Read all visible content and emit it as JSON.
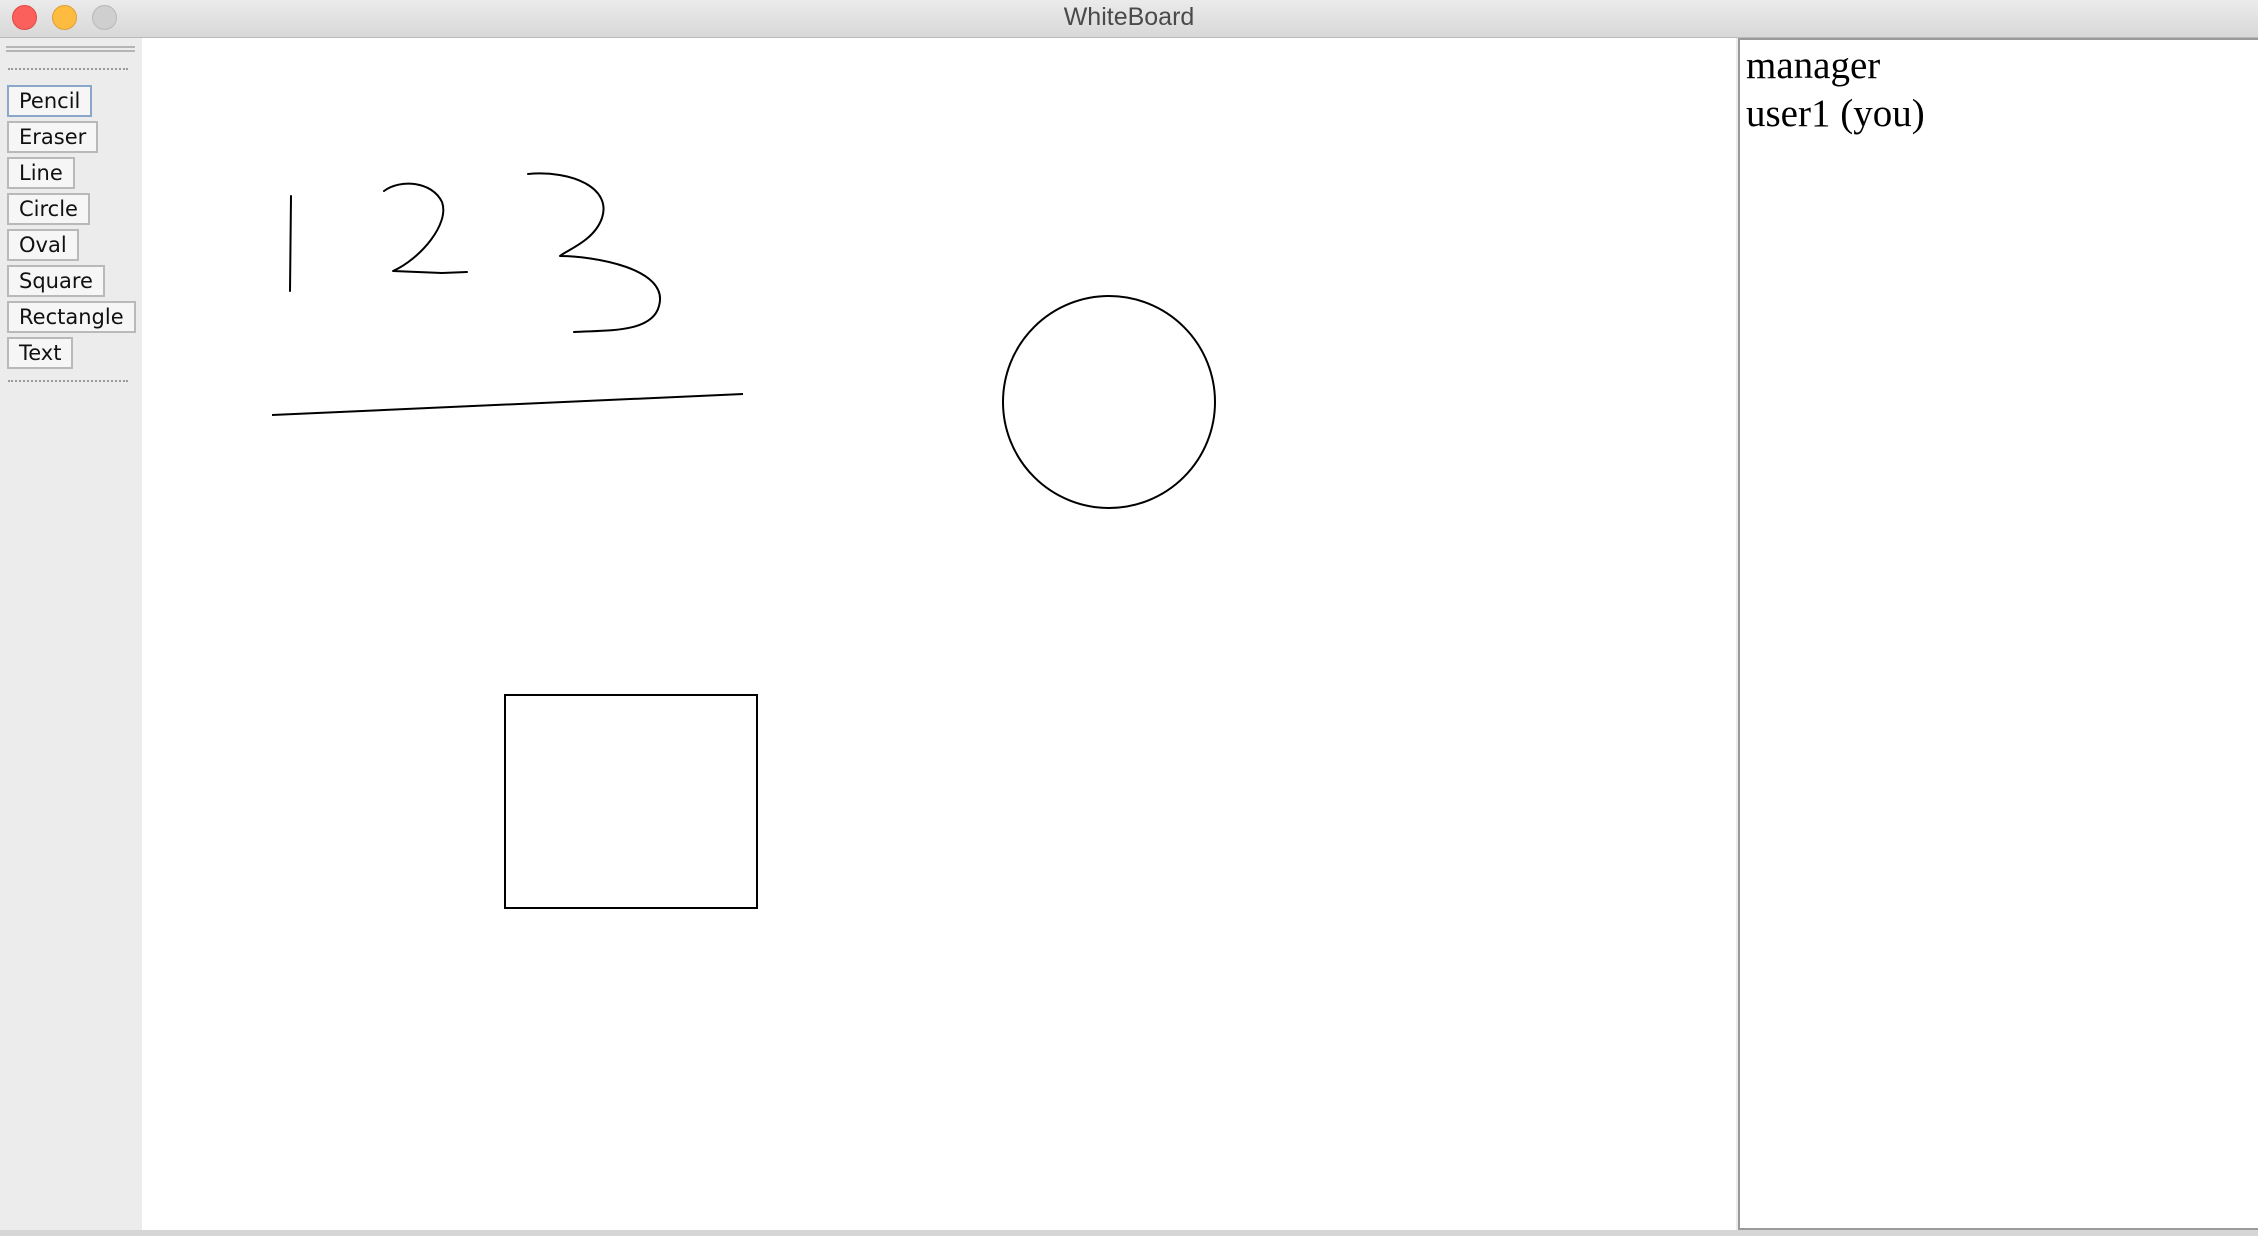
{
  "window": {
    "title": "WhiteBoard"
  },
  "toolbar": {
    "tools": [
      {
        "label": "Pencil",
        "icon": "pencil-icon"
      },
      {
        "label": "Eraser"
      },
      {
        "label": "Line"
      },
      {
        "label": "Circle"
      },
      {
        "label": "Oval"
      },
      {
        "label": "Square"
      },
      {
        "label": "Rectangle"
      },
      {
        "label": "Text"
      }
    ],
    "selected": "Pencil"
  },
  "canvas": {
    "drawn_items": [
      "handwritten-one",
      "handwritten-two",
      "handwritten-three",
      "line",
      "circle",
      "rectangle"
    ]
  },
  "users": {
    "list": [
      "manager",
      "user1 (you)"
    ]
  },
  "colors": {
    "close": "#fc605c",
    "minimize": "#fdbc40",
    "zoom_disabled": "#cfcfcf",
    "stroke": "#000000"
  }
}
